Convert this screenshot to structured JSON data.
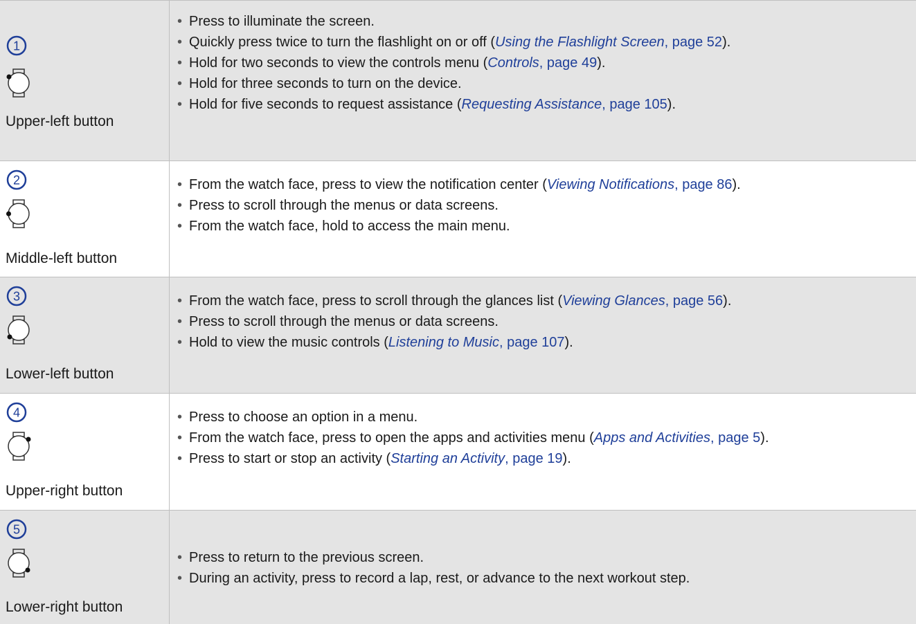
{
  "rows": [
    {
      "number": "1",
      "label": "Upper-left button",
      "icon": "watch-upper-left-button-icon",
      "items": [
        {
          "pre": "Press to illuminate the screen."
        },
        {
          "pre": "Quickly press twice to turn the flashlight on or off (",
          "ref_title": "Using the Flashlight Screen",
          "ref_page": ", page 52",
          "post": ")."
        },
        {
          "pre": "Hold for two seconds to view the controls menu (",
          "ref_title": "Controls",
          "ref_page": ", page 49",
          "post": ")."
        },
        {
          "pre": "Hold for three seconds to turn on the device."
        },
        {
          "pre": "Hold for five seconds to request assistance (",
          "ref_title": "Requesting Assistance",
          "ref_page": ", page 105",
          "post": ")."
        }
      ]
    },
    {
      "number": "2",
      "label": "Middle-left button",
      "icon": "watch-middle-left-button-icon",
      "items": [
        {
          "pre": "From the watch face, press to view the notification center (",
          "ref_title": "Viewing Notifications",
          "ref_page": ", page 86",
          "post": ")."
        },
        {
          "pre": "Press to scroll through the menus or data screens."
        },
        {
          "pre": "From the watch face, hold to access the main menu."
        }
      ]
    },
    {
      "number": "3",
      "label": "Lower-left button",
      "icon": "watch-lower-left-button-icon",
      "items": [
        {
          "pre": "From the watch face, press to scroll through the glances list (",
          "ref_title": "Viewing Glances",
          "ref_page": ", page 56",
          "post": ")."
        },
        {
          "pre": "Press to scroll through the menus or data screens."
        },
        {
          "pre": "Hold to view the music controls (",
          "ref_title": "Listening to Music",
          "ref_page": ", page 107",
          "post": ")."
        }
      ]
    },
    {
      "number": "4",
      "label": "Upper-right button",
      "icon": "watch-upper-right-button-icon",
      "items": [
        {
          "pre": "Press to choose an option in a menu."
        },
        {
          "pre": "From the watch face, press to open the apps and activities menu (",
          "ref_title": "Apps and Activities",
          "ref_page": ", page 5",
          "post": ")."
        },
        {
          "pre": "Press to start or stop an activity (",
          "ref_title": "Starting an Activity",
          "ref_page": ", page 19",
          "post": ")."
        }
      ]
    },
    {
      "number": "5",
      "label": "Lower-right button",
      "icon": "watch-lower-right-button-icon",
      "items": [
        {
          "pre": "Press to return to the previous screen."
        },
        {
          "pre": "During an activity, press to record a lap, rest, or advance to the next workout step."
        }
      ]
    }
  ],
  "colors": {
    "shaded_row": "#e4e4e4",
    "link": "#1f3f99",
    "number_circle": "#1f3f99"
  }
}
